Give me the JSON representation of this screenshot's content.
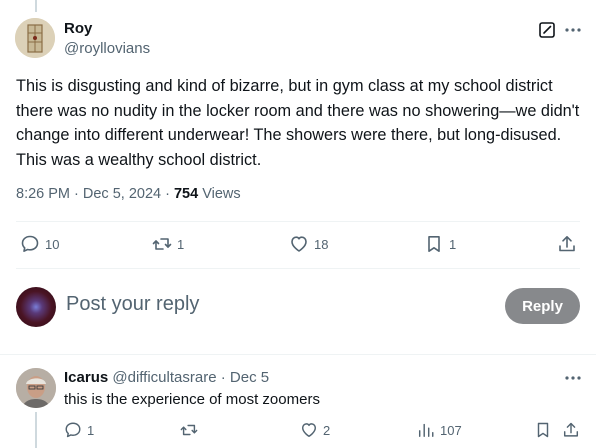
{
  "tweet": {
    "author_name": "Roy",
    "author_handle": "@royllovians",
    "text": "This is disgusting and kind of bizarre, but in gym class at my school district there was no nudity in the locker room and there was no showering—we didn't change into different underwear! The showers were there, but long-disused. This was a wealthy school district.",
    "timestamp": "8:26 PM · Dec 5, 2024",
    "separator": " · ",
    "views_count": "754",
    "views_label": "Views",
    "stats": {
      "replies": "10",
      "reposts": "1",
      "likes": "18",
      "bookmarks": "1"
    }
  },
  "composer": {
    "placeholder": "Post your reply",
    "button_label": "Reply"
  },
  "reply": {
    "author_name": "Icarus",
    "author_handle": "@difficultasrare",
    "date": "Dec 5",
    "separator": " · ",
    "text": "this is the experience of most zoomers",
    "stats": {
      "replies": "1",
      "likes": "2",
      "views": "107"
    }
  },
  "icons": {
    "edit": "edit-square-icon",
    "more": "more-dots-icon",
    "reply": "speech-bubble-icon",
    "repost": "repost-arrows-icon",
    "like": "heart-icon",
    "bookmark": "bookmark-icon",
    "share": "share-upload-icon",
    "views": "analytics-bars-icon"
  },
  "colors": {
    "text_primary": "#0f1419",
    "text_secondary": "#536471",
    "divider": "#eff3f4",
    "reply_button_disabled": "#87898c"
  }
}
